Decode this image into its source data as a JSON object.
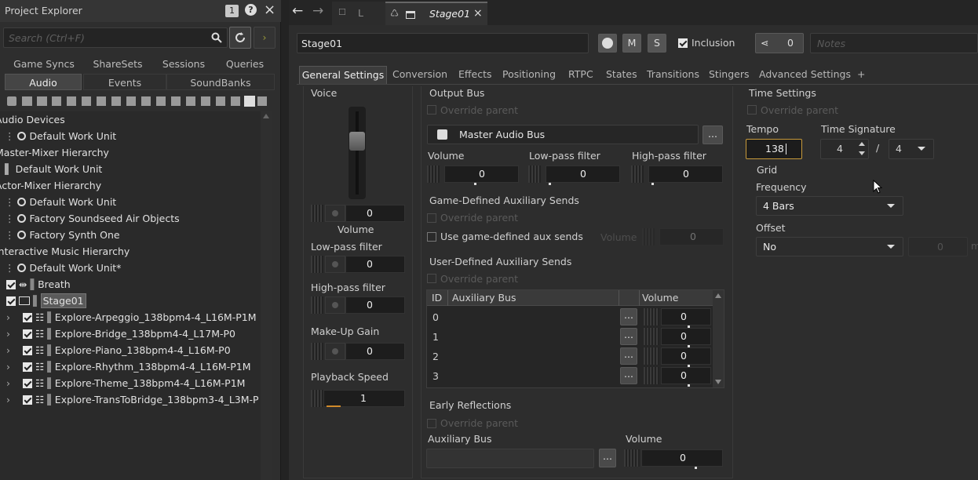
{
  "project_explorer": {
    "title": "Project Explorer",
    "badge": "1",
    "search_placeholder": "Search (Ctrl+F)",
    "tabs_row1": [
      "Game Syncs",
      "ShareSets",
      "Sessions",
      "Queries"
    ],
    "tabs_row2": [
      "Audio",
      "Events",
      "SoundBanks"
    ],
    "tree": [
      {
        "label": "Audio Devices"
      },
      {
        "label": "Default Work Unit"
      },
      {
        "label": "Master-Mixer Hierarchy"
      },
      {
        "label": "Default Work Unit"
      },
      {
        "label": "Actor-Mixer Hierarchy"
      },
      {
        "label": "Default Work Unit"
      },
      {
        "label": "Factory Soundseed Air Objects"
      },
      {
        "label": "Factory Synth One"
      },
      {
        "label": "Interactive Music Hierarchy"
      },
      {
        "label": "Default Work Unit*"
      },
      {
        "label": "Breath"
      },
      {
        "label": "Stage01"
      },
      {
        "label": "Explore-Arpeggio_138bpm4-4_L16M-P1M"
      },
      {
        "label": "Explore-Bridge_138bpm4-4_L17M-P0"
      },
      {
        "label": "Explore-Piano_138bpm4-4_L16M-P0"
      },
      {
        "label": "Explore-Rhythm_138bpm4-4_L16M-P1M"
      },
      {
        "label": "Explore-Theme_138bpm4-4_L16M-P1M"
      },
      {
        "label": "Explore-TransToBridge_138bpm3-4_L3M-P"
      }
    ]
  },
  "doc_tabs": {
    "tab1_label": "L",
    "tab2_label": "Stage01"
  },
  "editor": {
    "object_name": "Stage01",
    "m_label": "M",
    "s_label": "S",
    "inclusion_label": "Inclusion",
    "share_count": "0",
    "notes_placeholder": "Notes",
    "tabs": [
      "General Settings",
      "Conversion",
      "Effects",
      "Positioning",
      "RTPC",
      "States",
      "Transitions",
      "Stingers",
      "Advanced Settings",
      "+"
    ],
    "voice": {
      "section": "Voice",
      "volume_value": "0",
      "volume_label": "Volume",
      "lowpass_label": "Low-pass filter",
      "lowpass_value": "0",
      "highpass_label": "High-pass filter",
      "highpass_value": "0",
      "makeup_label": "Make-Up Gain",
      "makeup_value": "0",
      "playback_label": "Playback Speed",
      "playback_value": "1"
    },
    "output_bus": {
      "section": "Output Bus",
      "override": "Override parent",
      "bus_name": "Master Audio Bus",
      "browse": "...",
      "volume_label": "Volume",
      "volume_value": "0",
      "lowpass_label": "Low-pass filter",
      "lowpass_value": "0",
      "highpass_label": "High-pass filter",
      "highpass_value": "0"
    },
    "game_aux": {
      "section": "Game-Defined Auxiliary Sends",
      "override": "Override parent",
      "use_label": "Use game-defined aux sends",
      "volume_label": "Volume",
      "volume_value": "0"
    },
    "user_aux": {
      "section": "User-Defined Auxiliary Sends",
      "override": "Override parent",
      "col_id": "ID",
      "col_bus": "Auxiliary Bus",
      "col_volume": "Volume",
      "rows": [
        {
          "id": "0",
          "volume": "0"
        },
        {
          "id": "1",
          "volume": "0"
        },
        {
          "id": "2",
          "volume": "0"
        },
        {
          "id": "3",
          "volume": "0"
        }
      ]
    },
    "early_reflections": {
      "section": "Early Reflections",
      "override": "Override parent",
      "aux_label": "Auxiliary Bus",
      "volume_label": "Volume",
      "volume_value": "0"
    },
    "time_settings": {
      "section": "Time Settings",
      "override": "Override parent",
      "tempo_label": "Tempo",
      "tempo_value": "138",
      "sig_label": "Time Signature",
      "sig_num": "4",
      "sig_sep": "/",
      "sig_den": "4",
      "grid_label": "Grid",
      "frequency_label": "Frequency",
      "frequency_value": "4 Bars",
      "offset_label": "Offset",
      "offset_value": "No",
      "offset_num": "0",
      "offset_unit": "m"
    }
  }
}
